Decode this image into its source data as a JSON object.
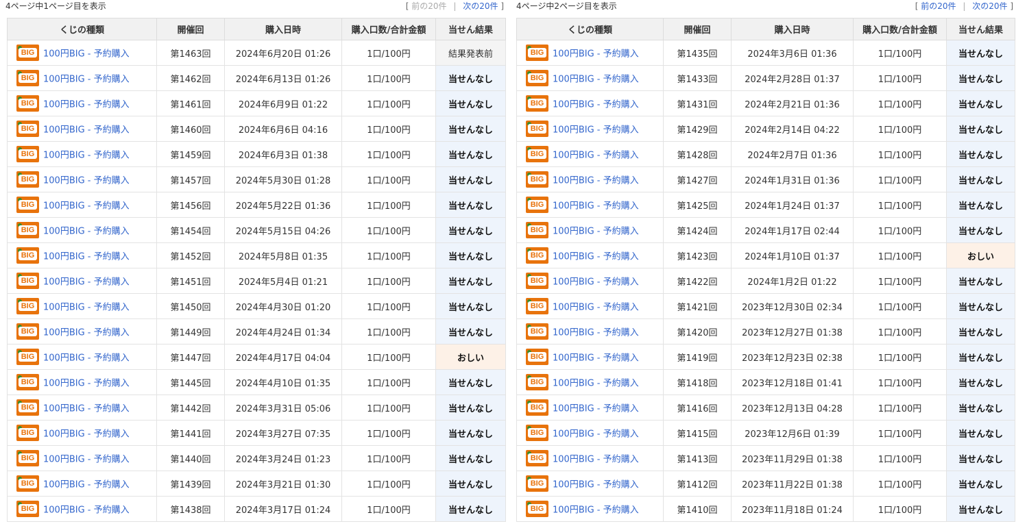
{
  "panels": [
    {
      "page_info": "4ページ中1ページ目を表示",
      "pager": {
        "open": "[",
        "prev": "前の20件",
        "prev_enabled": false,
        "sep": "|",
        "next": "次の20件",
        "close": "]"
      },
      "headers": [
        "くじの種類",
        "開催回",
        "購入日時",
        "購入口数/合計金額",
        "当せん結果"
      ],
      "rows": [
        {
          "type": "100円BIG - 予約購入",
          "round": "第1463回",
          "date": "2024年6月20日 01:26",
          "amount": "1口/100円",
          "result": "結果発表前",
          "status": "pending"
        },
        {
          "type": "100円BIG - 予約購入",
          "round": "第1462回",
          "date": "2024年6月13日 01:26",
          "amount": "1口/100円",
          "result": "当せんなし",
          "status": "none"
        },
        {
          "type": "100円BIG - 予約購入",
          "round": "第1461回",
          "date": "2024年6月9日 01:22",
          "amount": "1口/100円",
          "result": "当せんなし",
          "status": "none"
        },
        {
          "type": "100円BIG - 予約購入",
          "round": "第1460回",
          "date": "2024年6月6日 04:16",
          "amount": "1口/100円",
          "result": "当せんなし",
          "status": "none"
        },
        {
          "type": "100円BIG - 予約購入",
          "round": "第1459回",
          "date": "2024年6月3日 01:38",
          "amount": "1口/100円",
          "result": "当せんなし",
          "status": "none"
        },
        {
          "type": "100円BIG - 予約購入",
          "round": "第1457回",
          "date": "2024年5月30日 01:28",
          "amount": "1口/100円",
          "result": "当せんなし",
          "status": "none"
        },
        {
          "type": "100円BIG - 予約購入",
          "round": "第1456回",
          "date": "2024年5月22日 01:36",
          "amount": "1口/100円",
          "result": "当せんなし",
          "status": "none"
        },
        {
          "type": "100円BIG - 予約購入",
          "round": "第1454回",
          "date": "2024年5月15日 04:26",
          "amount": "1口/100円",
          "result": "当せんなし",
          "status": "none"
        },
        {
          "type": "100円BIG - 予約購入",
          "round": "第1452回",
          "date": "2024年5月8日 01:35",
          "amount": "1口/100円",
          "result": "当せんなし",
          "status": "none"
        },
        {
          "type": "100円BIG - 予約購入",
          "round": "第1451回",
          "date": "2024年5月4日 01:21",
          "amount": "1口/100円",
          "result": "当せんなし",
          "status": "none"
        },
        {
          "type": "100円BIG - 予約購入",
          "round": "第1450回",
          "date": "2024年4月30日 01:20",
          "amount": "1口/100円",
          "result": "当せんなし",
          "status": "none"
        },
        {
          "type": "100円BIG - 予約購入",
          "round": "第1449回",
          "date": "2024年4月24日 01:34",
          "amount": "1口/100円",
          "result": "当せんなし",
          "status": "none"
        },
        {
          "type": "100円BIG - 予約購入",
          "round": "第1447回",
          "date": "2024年4月17日 04:04",
          "amount": "1口/100円",
          "result": "おしい",
          "status": "close"
        },
        {
          "type": "100円BIG - 予約購入",
          "round": "第1445回",
          "date": "2024年4月10日 01:35",
          "amount": "1口/100円",
          "result": "当せんなし",
          "status": "none"
        },
        {
          "type": "100円BIG - 予約購入",
          "round": "第1442回",
          "date": "2024年3月31日 05:06",
          "amount": "1口/100円",
          "result": "当せんなし",
          "status": "none"
        },
        {
          "type": "100円BIG - 予約購入",
          "round": "第1441回",
          "date": "2024年3月27日 07:35",
          "amount": "1口/100円",
          "result": "当せんなし",
          "status": "none"
        },
        {
          "type": "100円BIG - 予約購入",
          "round": "第1440回",
          "date": "2024年3月24日 01:23",
          "amount": "1口/100円",
          "result": "当せんなし",
          "status": "none"
        },
        {
          "type": "100円BIG - 予約購入",
          "round": "第1439回",
          "date": "2024年3月21日 01:30",
          "amount": "1口/100円",
          "result": "当せんなし",
          "status": "none"
        },
        {
          "type": "100円BIG - 予約購入",
          "round": "第1438回",
          "date": "2024年3月17日 01:24",
          "amount": "1口/100円",
          "result": "当せんなし",
          "status": "none"
        }
      ]
    },
    {
      "page_info": "4ページ中2ページ目を表示",
      "pager": {
        "open": "[",
        "prev": "前の20件",
        "prev_enabled": true,
        "sep": "|",
        "next": "次の20件",
        "close": "]"
      },
      "headers": [
        "くじの種類",
        "開催回",
        "購入日時",
        "購入口数/合計金額",
        "当せん結果"
      ],
      "rows": [
        {
          "type": "100円BIG - 予約購入",
          "round": "第1435回",
          "date": "2024年3月6日 01:36",
          "amount": "1口/100円",
          "result": "当せんなし",
          "status": "none"
        },
        {
          "type": "100円BIG - 予約購入",
          "round": "第1433回",
          "date": "2024年2月28日 01:37",
          "amount": "1口/100円",
          "result": "当せんなし",
          "status": "none"
        },
        {
          "type": "100円BIG - 予約購入",
          "round": "第1431回",
          "date": "2024年2月21日 01:36",
          "amount": "1口/100円",
          "result": "当せんなし",
          "status": "none"
        },
        {
          "type": "100円BIG - 予約購入",
          "round": "第1429回",
          "date": "2024年2月14日 04:22",
          "amount": "1口/100円",
          "result": "当せんなし",
          "status": "none"
        },
        {
          "type": "100円BIG - 予約購入",
          "round": "第1428回",
          "date": "2024年2月7日 01:36",
          "amount": "1口/100円",
          "result": "当せんなし",
          "status": "none"
        },
        {
          "type": "100円BIG - 予約購入",
          "round": "第1427回",
          "date": "2024年1月31日 01:36",
          "amount": "1口/100円",
          "result": "当せんなし",
          "status": "none"
        },
        {
          "type": "100円BIG - 予約購入",
          "round": "第1425回",
          "date": "2024年1月24日 01:37",
          "amount": "1口/100円",
          "result": "当せんなし",
          "status": "none"
        },
        {
          "type": "100円BIG - 予約購入",
          "round": "第1424回",
          "date": "2024年1月17日 02:44",
          "amount": "1口/100円",
          "result": "当せんなし",
          "status": "none"
        },
        {
          "type": "100円BIG - 予約購入",
          "round": "第1423回",
          "date": "2024年1月10日 01:37",
          "amount": "1口/100円",
          "result": "おしい",
          "status": "close"
        },
        {
          "type": "100円BIG - 予約購入",
          "round": "第1422回",
          "date": "2024年1月2日 01:22",
          "amount": "1口/100円",
          "result": "当せんなし",
          "status": "none"
        },
        {
          "type": "100円BIG - 予約購入",
          "round": "第1421回",
          "date": "2023年12月30日 02:34",
          "amount": "1口/100円",
          "result": "当せんなし",
          "status": "none"
        },
        {
          "type": "100円BIG - 予約購入",
          "round": "第1420回",
          "date": "2023年12月27日 01:38",
          "amount": "1口/100円",
          "result": "当せんなし",
          "status": "none"
        },
        {
          "type": "100円BIG - 予約購入",
          "round": "第1419回",
          "date": "2023年12月23日 02:38",
          "amount": "1口/100円",
          "result": "当せんなし",
          "status": "none"
        },
        {
          "type": "100円BIG - 予約購入",
          "round": "第1418回",
          "date": "2023年12月18日 01:41",
          "amount": "1口/100円",
          "result": "当せんなし",
          "status": "none"
        },
        {
          "type": "100円BIG - 予約購入",
          "round": "第1416回",
          "date": "2023年12月13日 04:28",
          "amount": "1口/100円",
          "result": "当せんなし",
          "status": "none"
        },
        {
          "type": "100円BIG - 予約購入",
          "round": "第1415回",
          "date": "2023年12月6日 01:39",
          "amount": "1口/100円",
          "result": "当せんなし",
          "status": "none"
        },
        {
          "type": "100円BIG - 予約購入",
          "round": "第1413回",
          "date": "2023年11月29日 01:38",
          "amount": "1口/100円",
          "result": "当せんなし",
          "status": "none"
        },
        {
          "type": "100円BIG - 予約購入",
          "round": "第1412回",
          "date": "2023年11月22日 01:38",
          "amount": "1口/100円",
          "result": "当せんなし",
          "status": "none"
        },
        {
          "type": "100円BIG - 予約購入",
          "round": "第1410回",
          "date": "2023年11月18日 01:24",
          "amount": "1口/100円",
          "result": "当せんなし",
          "status": "none"
        }
      ]
    }
  ],
  "logo": {
    "text": "BIG",
    "icon": "big-logo-icon"
  },
  "colors": {
    "link": "#3366cc",
    "logo_bg": "#e8730c",
    "result_none_bg": "#eef4fc",
    "result_close_bg": "#fdf1e7",
    "header_bg": "#f1f1f1"
  }
}
